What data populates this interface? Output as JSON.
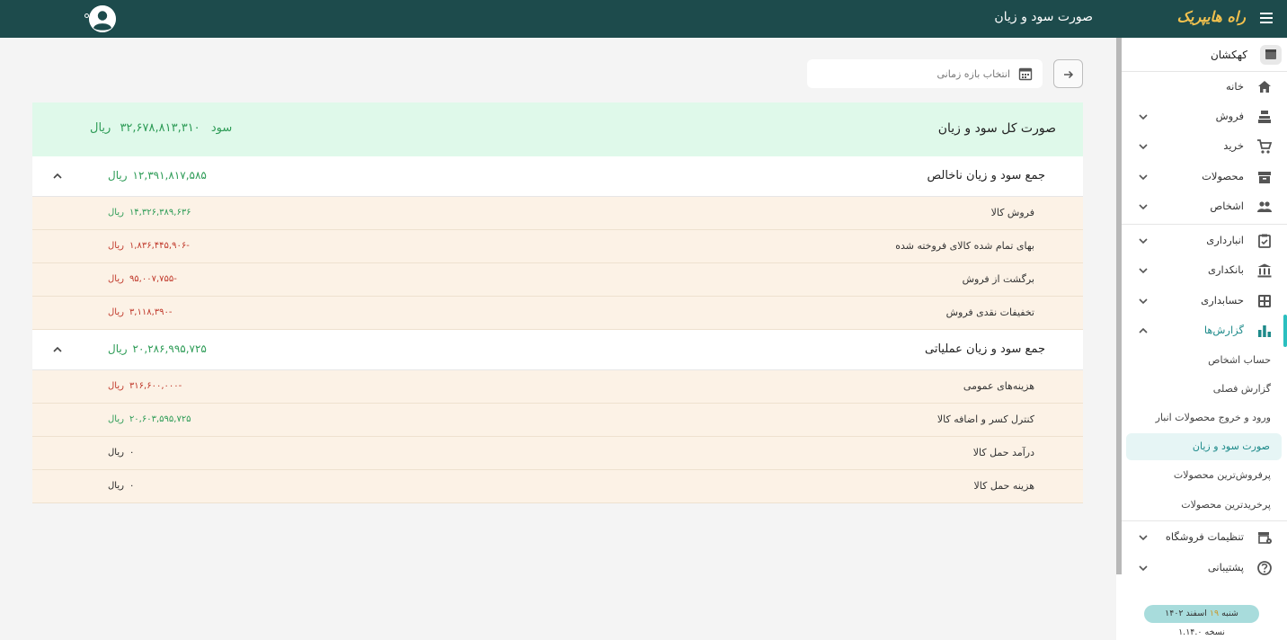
{
  "header": {
    "title": "صورت سود و زیان"
  },
  "sidebar": {
    "brand": "راه هایپریک",
    "workspace": "کهکشان",
    "items": [
      {
        "label": "خانه",
        "icon": "home-icon"
      },
      {
        "label": "فروش",
        "icon": "cash-register-icon"
      },
      {
        "label": "خرید",
        "icon": "cart-icon"
      },
      {
        "label": "محصولات",
        "icon": "archive-icon"
      },
      {
        "label": "اشخاص",
        "icon": "people-icon"
      },
      {
        "label": "انبارداری",
        "icon": "inventory-icon"
      },
      {
        "label": "بانکداری",
        "icon": "bank-icon"
      },
      {
        "label": "حسابداری",
        "icon": "calculator-icon"
      },
      {
        "label": "گزارش‌ها",
        "icon": "bar-chart-icon"
      },
      {
        "label": "تنظیمات فروشگاه",
        "icon": "store-settings-icon"
      },
      {
        "label": "پشتیبانی",
        "icon": "support-icon"
      }
    ],
    "reports_sub": [
      "حساب اشخاص",
      "گزارش فصلی",
      "ورود و خروج محصولات انبار",
      "صورت سود و زیان",
      "پرفروش‌ترین محصولات",
      "پرخریدترین محصولات"
    ],
    "date": {
      "day": "شنبه",
      "num": "۱۹",
      "month_year": "اسفند ۱۴۰۲"
    },
    "version": "نسخه ۱.۱۴.۰"
  },
  "filter": {
    "date_placeholder": "انتخاب بازه زمانی"
  },
  "report": {
    "title": "صورت کل سود و زیان",
    "total_label": "سود",
    "total_value": "۳۲,۶۷۸,۸۱۳,۳۱۰",
    "currency": "ریال",
    "sections": [
      {
        "label": "جمع سود و زیان ناخالص",
        "value": "۱۲,۳۹۱,۸۱۷,۵۸۵",
        "items": [
          {
            "label": "فروش کالا",
            "value": "۱۴,۳۲۶,۳۸۹,۶۳۶"
          },
          {
            "label": "بهای تمام شده کالای فروخته شده",
            "value": "-۱,۸۳۶,۴۴۵,۹۰۶"
          },
          {
            "label": "برگشت از فروش",
            "value": "-۹۵,۰۰۷,۷۵۵"
          },
          {
            "label": "تخفیفات نقدی فروش",
            "value": "-۳,۱۱۸,۳۹۰"
          }
        ]
      },
      {
        "label": "جمع سود و زیان عملیاتی",
        "value": "۲۰,۲۸۶,۹۹۵,۷۲۵",
        "items": [
          {
            "label": "هزینه‌های عمومی",
            "value": "-۳۱۶,۶۰۰,۰۰۰"
          },
          {
            "label": "کنترل کسر و اضافه کالا",
            "value": "۲۰,۶۰۳,۵۹۵,۷۲۵"
          },
          {
            "label": "درآمد حمل کالا",
            "value": "۰"
          },
          {
            "label": "هزینه حمل کالا",
            "value": "۰"
          }
        ]
      }
    ]
  }
}
